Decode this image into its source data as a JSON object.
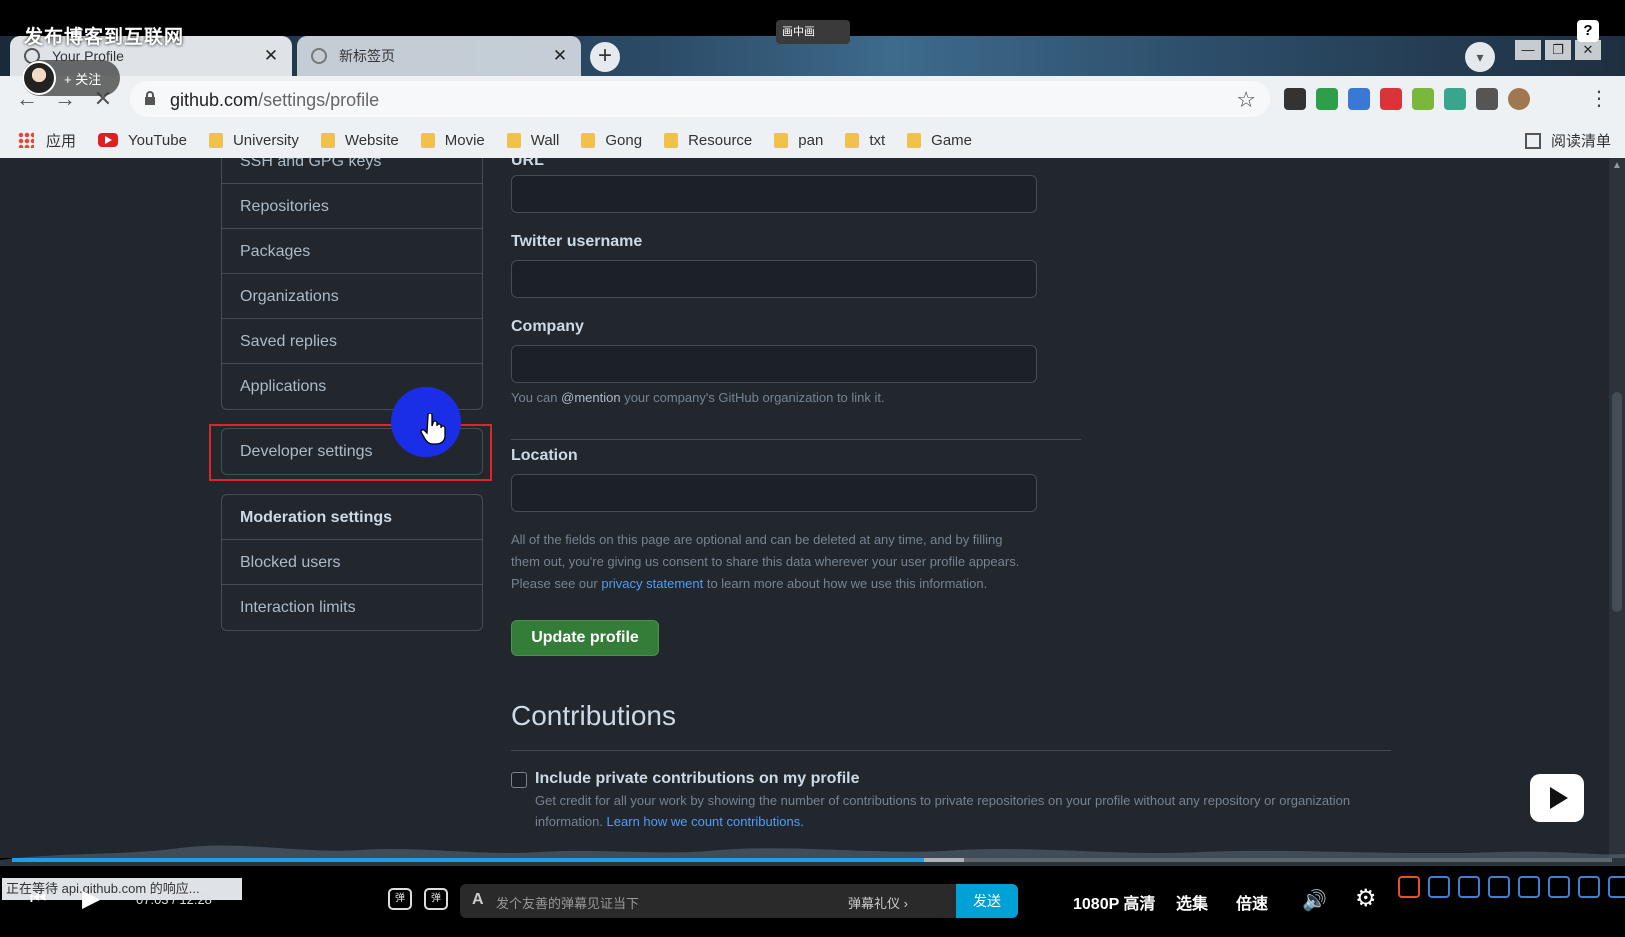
{
  "video_overlay": {
    "title": "发布博客到互联网",
    "pip_label": "画中画",
    "help": "?",
    "follow_label": "+ 关注"
  },
  "browser": {
    "tabs": [
      {
        "title": "Your Profile",
        "close": "✕"
      },
      {
        "title": "新标签页",
        "close": "✕"
      }
    ],
    "new_tab": "+",
    "window_controls": [
      "—",
      "❐",
      "✕"
    ],
    "address": {
      "host": "github.com",
      "path": "/settings/profile"
    },
    "bookmarks": [
      {
        "label": "应用",
        "type": "apps"
      },
      {
        "label": "YouTube",
        "type": "youtube"
      },
      {
        "label": "University",
        "type": "folder"
      },
      {
        "label": "Website",
        "type": "folder"
      },
      {
        "label": "Movie",
        "type": "folder"
      },
      {
        "label": "Wall",
        "type": "folder"
      },
      {
        "label": "Gong",
        "type": "folder"
      },
      {
        "label": "Resource",
        "type": "folder"
      },
      {
        "label": "pan",
        "type": "folder"
      },
      {
        "label": "txt",
        "type": "folder"
      },
      {
        "label": "Game",
        "type": "folder"
      }
    ],
    "reading_list": "阅读清单"
  },
  "settings_nav": {
    "top_group": [
      "SSH and GPG keys",
      "Repositories",
      "Packages",
      "Organizations",
      "Saved replies",
      "Applications"
    ],
    "developer_settings": "Developer settings",
    "moderation_header": "Moderation settings",
    "moderation_items": [
      "Blocked users",
      "Interaction limits"
    ]
  },
  "profile_form": {
    "url_label": "URL",
    "twitter_label": "Twitter username",
    "company_label": "Company",
    "company_note_pre": "You can ",
    "company_note_mention": "@mention",
    "company_note_post": " your company's GitHub organization to link it.",
    "location_label": "Location",
    "optional_note_1": "All of the fields on this page are optional and can be deleted at any time, and by filling",
    "optional_note_2": "them out, you're giving us consent to share this data wherever your user profile appears.",
    "optional_note_3_pre": "Please see our ",
    "optional_note_3_link": "privacy statement",
    "optional_note_3_post": " to learn more about how we use this information.",
    "update_button": "Update profile"
  },
  "contributions": {
    "title": "Contributions",
    "checkbox_label": "Include private contributions on my profile",
    "checked": false,
    "note": "Get credit for all your work by showing the number of contributions to private repositories on your profile without any repository or organization information.",
    "note_link": "Learn how we count contributions."
  },
  "player": {
    "status_toast": "正在等待 api.github.com 的响应...",
    "time": "07:03 / 12:28",
    "progress": 0.57,
    "danmaku_placeholder": "发个友善的弹幕见证当下",
    "danmaku_gift": "弹幕礼仪 ›",
    "send": "发送",
    "quality": "1080P 高清",
    "episodes": "选集",
    "speed": "倍速"
  },
  "colors": {
    "page_bg": "#22272e",
    "accent_green": "#347d39",
    "link_blue": "#539bf5",
    "highlight_red": "#e0242c",
    "progress_blue": "#1fa0e6"
  }
}
